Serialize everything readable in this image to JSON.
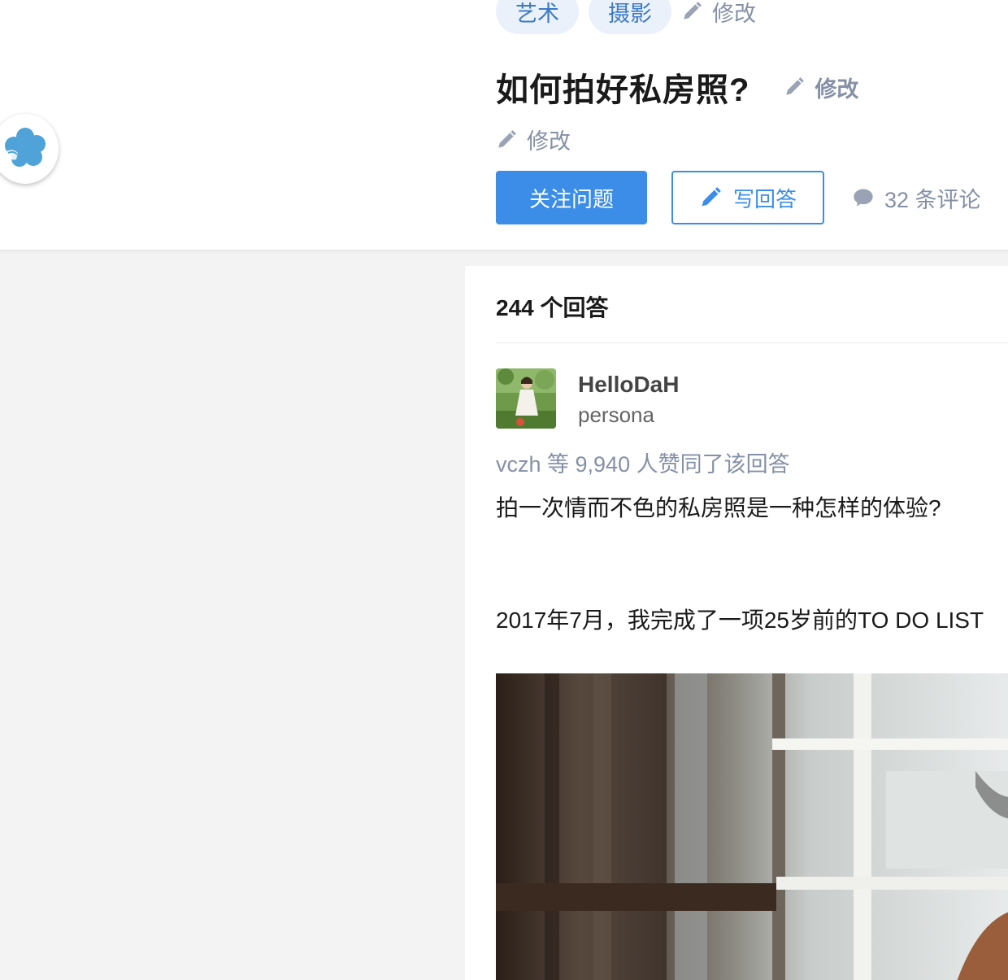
{
  "header": {
    "topics": [
      "艺术",
      "摄影"
    ],
    "topics_edit_label": "修改",
    "question_title": "如何拍好私房照?",
    "title_edit_label": "修改",
    "detail_edit_label": "修改",
    "follow_button_label": "关注问题",
    "write_answer_label": "写回答",
    "comments_label": "32 条评论"
  },
  "answers": {
    "count_label": "244 个回答",
    "first": {
      "author_name": "HelloDaH",
      "author_bio": "persona",
      "voters_text": "vczh 等 9,940 人赞同了该回答",
      "paragraph1": "拍一次情而不色的私房照是一种怎样的体验?",
      "paragraph2": "2017年7月，我完成了一项25岁前的TO DO LIST"
    }
  },
  "icons": {
    "logo": "flower-logo-icon",
    "edit": "pencil-icon",
    "comment": "speech-bubble-icon"
  },
  "colors": {
    "accent": "#3b8de8",
    "tag_bg": "#eaf1fb",
    "tag_text": "#3b79c7",
    "muted": "#8590a6"
  }
}
